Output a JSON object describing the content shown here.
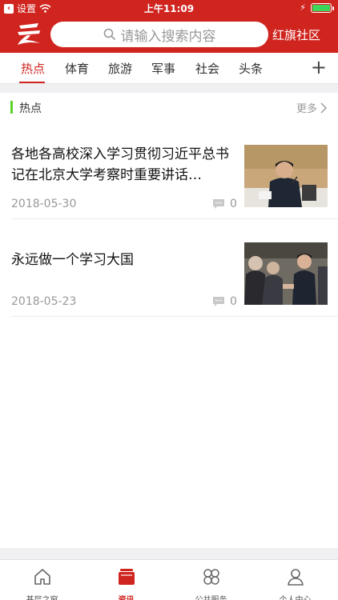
{
  "status": {
    "back_label": "设置",
    "time": "上午11:09"
  },
  "header": {
    "search_placeholder": "请输入搜索内容",
    "community_label": "红旗社区"
  },
  "tabs": [
    {
      "label": "热点",
      "active": true
    },
    {
      "label": "体育",
      "active": false
    },
    {
      "label": "旅游",
      "active": false
    },
    {
      "label": "军事",
      "active": false
    },
    {
      "label": "社会",
      "active": false
    },
    {
      "label": "头条",
      "active": false
    }
  ],
  "section": {
    "title": "热点",
    "more_label": "更多"
  },
  "news": [
    {
      "title": "各地各高校深入学习贯彻习近平总书记在北京大学考察时重要讲话…",
      "date": "2018-05-30",
      "comments": "0"
    },
    {
      "title": "永远做一个学习大国",
      "date": "2018-05-23",
      "comments": "0"
    }
  ],
  "bottom_nav": [
    {
      "label": "基层之窗",
      "icon": "home-icon",
      "active": false
    },
    {
      "label": "资讯",
      "icon": "news-icon",
      "active": true
    },
    {
      "label": "公共服务",
      "icon": "clover-icon",
      "active": false
    },
    {
      "label": "个人中心",
      "icon": "person-icon",
      "active": false
    }
  ],
  "colors": {
    "brand_red": "#d0241f",
    "section_bar_green": "#5ad22b",
    "battery_green": "#3fd45a"
  }
}
